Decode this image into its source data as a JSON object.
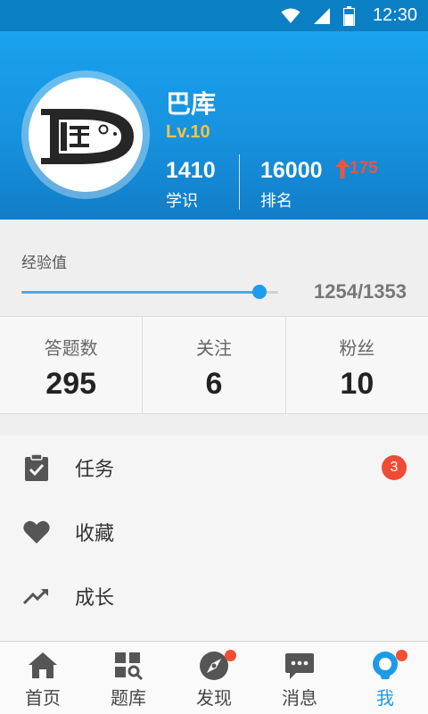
{
  "status_bar": {
    "time": "12:30"
  },
  "profile": {
    "name": "巴库",
    "level": "Lv.10",
    "knowledge_value": "1410",
    "knowledge_label": "学识",
    "rank_value": "16000",
    "rank_label": "排名",
    "rank_change": "175"
  },
  "experience": {
    "label": "经验值",
    "value_text": "1254/1353",
    "progress": 0.927
  },
  "counts": [
    {
      "label": "答题数",
      "value": "295"
    },
    {
      "label": "关注",
      "value": "6"
    },
    {
      "label": "粉丝",
      "value": "10"
    }
  ],
  "menu": [
    {
      "label": "任务",
      "icon": "clipboard-check-icon",
      "badge": "3"
    },
    {
      "label": "收藏",
      "icon": "heart-icon"
    },
    {
      "label": "成长",
      "icon": "trending-up-icon"
    }
  ],
  "bottom_nav": [
    {
      "label": "首页",
      "icon": "home-icon"
    },
    {
      "label": "题库",
      "icon": "grid-search-icon"
    },
    {
      "label": "发现",
      "icon": "compass-icon",
      "dot": true
    },
    {
      "label": "消息",
      "icon": "chat-bubble-icon"
    },
    {
      "label": "我",
      "icon": "bulb-profile-icon",
      "dot": true,
      "active": true
    }
  ],
  "colors": {
    "primary": "#1c9be6",
    "header_top": "#1aa2ee",
    "level_gold": "#f3c34a",
    "badge_red": "#ef4b36"
  }
}
